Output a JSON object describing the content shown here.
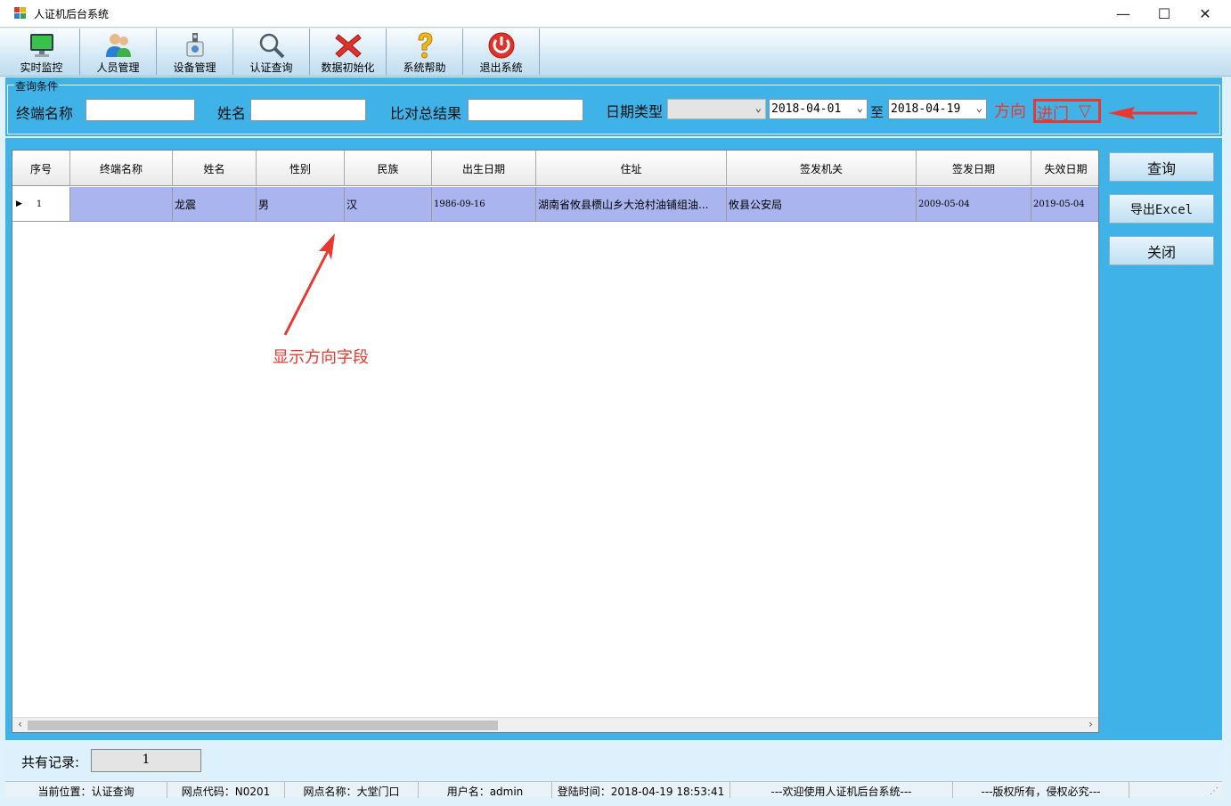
{
  "window": {
    "title": "人证机后台系统",
    "minimize": "—",
    "maximize": "☐",
    "close": "✕"
  },
  "toolbar": [
    {
      "label": "实时监控",
      "icon": "monitor-icon"
    },
    {
      "label": "人员管理",
      "icon": "users-icon"
    },
    {
      "label": "设备管理",
      "icon": "device-icon"
    },
    {
      "label": "认证查询",
      "icon": "magnifier-icon"
    },
    {
      "label": "数据初始化",
      "icon": "red-x-icon"
    },
    {
      "label": "系统帮助",
      "icon": "question-icon"
    },
    {
      "label": "退出系统",
      "icon": "power-icon"
    }
  ],
  "query": {
    "legend": "查询条件",
    "terminal_label": "终端名称",
    "name_label": "姓名",
    "result_label": "比对总结果",
    "date_type_label": "日期类型",
    "date_from": "2018-04-01",
    "to_label": "至",
    "date_to": "2018-04-19",
    "direction_label": "方向",
    "direction_value": "进门",
    "direction_arrow": "▽",
    "combo_arrow": "⌄"
  },
  "grid": {
    "columns": [
      "序号",
      "终端名称",
      "姓名",
      "性别",
      "民族",
      "出生日期",
      "住址",
      "签发机关",
      "签发日期",
      "失效日期"
    ],
    "row_marker": "▶",
    "rows": [
      [
        "1",
        "",
        "龙震",
        "男",
        "汉",
        "1986-09-16",
        "湖南省攸县槚山乡大沧村油铺组油...",
        "攸县公安局",
        "2009-05-04",
        "2019-05-04"
      ]
    ],
    "scroll_left": "‹",
    "scroll_right": "›"
  },
  "annotation": "显示方向字段",
  "side_buttons": {
    "query": "查询",
    "export": "导出Excel",
    "close": "关闭"
  },
  "footer": {
    "count_label": "共有记录:",
    "count_value": "1"
  },
  "status": {
    "location": "当前位置：认证查询",
    "site_code": "网点代码：N0201",
    "site_name": "网点名称：大堂门口",
    "user": "用户名：admin",
    "login_time": "登陆时间：2018-04-19 18:53:41",
    "welcome": "---欢迎使用人证机后台系统---",
    "copyright": "---版权所有，侵权必究---"
  },
  "colors": {
    "accent_blue": "#3fb3e8",
    "annotation_red": "#e8382f",
    "selected_row": "#aab4ee"
  }
}
